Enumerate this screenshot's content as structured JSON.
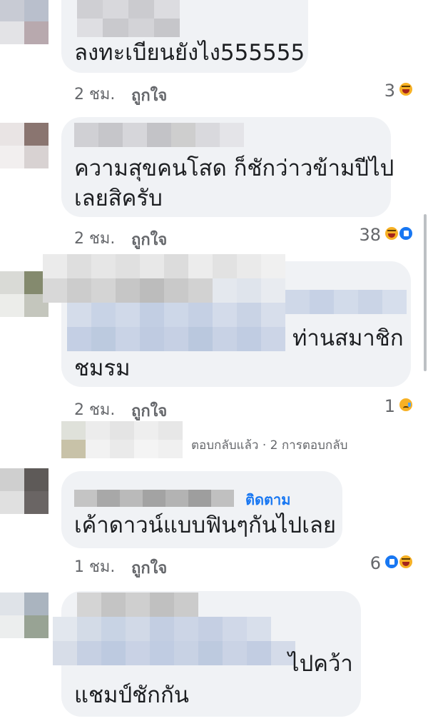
{
  "comments": [
    {
      "text_lines": [
        "ลงทะเบียนยังไง555555"
      ],
      "time": "2 ชม.",
      "like_label": "ถูกใจ",
      "reaction_count": "3"
    },
    {
      "text_lines": [
        "ความสุขคนโสด ก็ชักว่าวข้ามปีไป",
        "เลยสิครับ"
      ],
      "time": "2 ชม.",
      "like_label": "ถูกใจ",
      "reaction_count": "38"
    },
    {
      "text_lines": [
        "ท่านสมาชิก",
        "ชมรม"
      ],
      "time": "2 ชม.",
      "like_label": "ถูกใจ",
      "reaction_count": "1",
      "replies_summary": "ตอบกลับแล้ว · 2 การตอบกลับ"
    },
    {
      "follow_label": "ติดตาม",
      "text_lines": [
        "เค้าดาวน์แบบฟินๆกันไปเลย"
      ],
      "time": "1 ชม.",
      "like_label": "ถูกใจ",
      "reaction_count": "6"
    },
    {
      "text_lines": [
        "ไปคว้า",
        "แชมป์ชักกัน"
      ]
    }
  ],
  "colors": {
    "bubble": "#f0f2f5",
    "meta_text": "#65676b",
    "link": "#1877f2"
  },
  "icons": {
    "haha": "haha-reaction-icon",
    "like": "like-reaction-icon",
    "sad": "sad-reaction-icon"
  }
}
